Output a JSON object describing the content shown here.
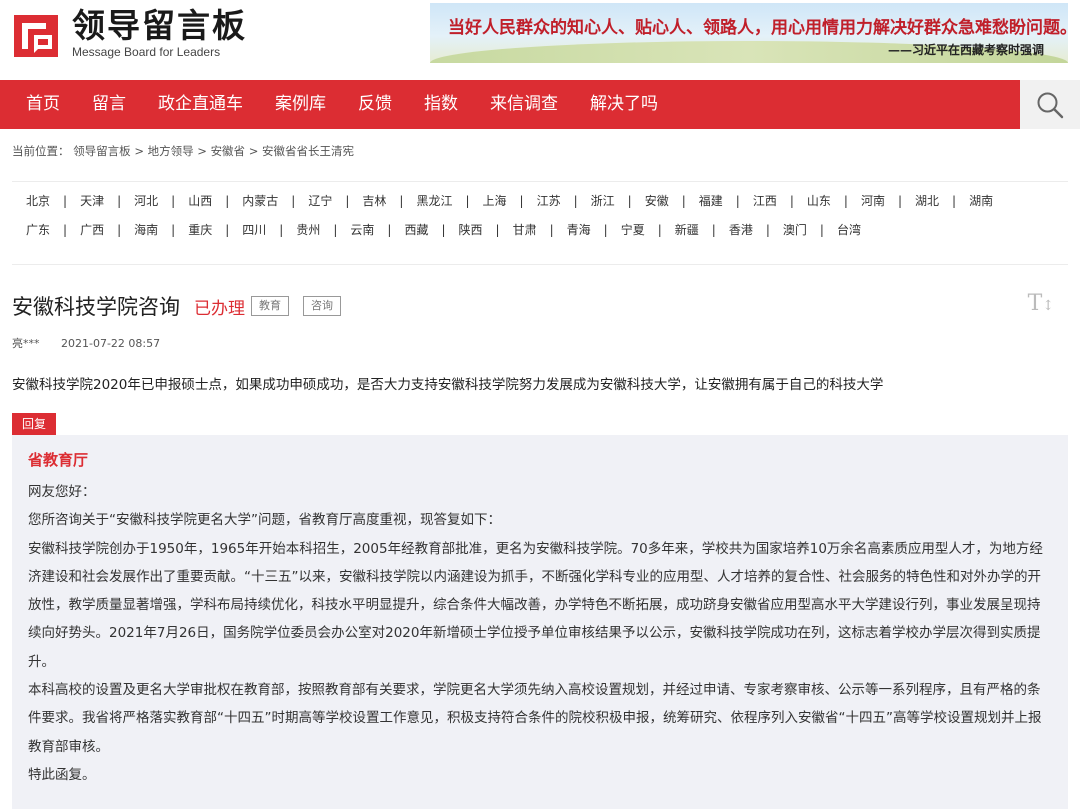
{
  "header": {
    "logo_cn": "领导留言板",
    "logo_en": "Message Board for Leaders",
    "banner_main": "当好人民群众的知心人、贴心人、领路人，用心用情用力解决好群众急难愁盼问题。",
    "banner_sub": "——习近平在西藏考察时强调"
  },
  "nav": {
    "items": [
      "首页",
      "留言",
      "政企直通车",
      "案例库",
      "反馈",
      "指数",
      "来信调查",
      "解决了吗"
    ]
  },
  "breadcrumb": {
    "prefix": "当前位置：",
    "path": [
      "领导留言板",
      "地方领导",
      "安徽省",
      "安徽省省长王清宪"
    ],
    "separator": ">"
  },
  "regions": {
    "row1": [
      "北京",
      "天津",
      "河北",
      "山西",
      "内蒙古",
      "辽宁",
      "吉林",
      "黑龙江",
      "上海",
      "江苏",
      "浙江",
      "安徽",
      "福建",
      "江西",
      "山东",
      "河南",
      "湖北",
      "湖南"
    ],
    "row2": [
      "广东",
      "广西",
      "海南",
      "重庆",
      "四川",
      "贵州",
      "云南",
      "西藏",
      "陕西",
      "甘肃",
      "青海",
      "宁夏",
      "新疆",
      "香港",
      "澳门",
      "台湾"
    ],
    "separator": "|"
  },
  "post": {
    "title": "安徽科技学院咨询",
    "status": "已办理",
    "tags": [
      "教育",
      "咨询"
    ],
    "font_icon_label": "T",
    "author": "亮***",
    "date": "2021-07-22 08:57",
    "content": "安徽科技学院2020年已申报硕士点，如果成功申硕成功，是否大力支持安徽科技学院努力发展成为安徽科技大学，让安徽拥有属于自己的科技大学"
  },
  "reply": {
    "tab_label": "回复",
    "org": "省教育厅",
    "paragraphs": [
      "网友您好：",
      "您所咨询关于“安徽科技学院更名大学”问题，省教育厅高度重视，现答复如下：",
      "安徽科技学院创办于1950年，1965年开始本科招生，2005年经教育部批准，更名为安徽科技学院。70多年来，学校共为国家培养10万余名高素质应用型人才，为地方经济建设和社会发展作出了重要贡献。“十三五”以来，安徽科技学院以内涵建设为抓手，不断强化学科专业的应用型、人才培养的复合性、社会服务的特色性和对外办学的开放性，教学质量显著增强，学科布局持续优化，科技水平明显提升，综合条件大幅改善，办学特色不断拓展，成功跻身安徽省应用型高水平大学建设行列，事业发展呈现持续向好势头。2021年7月26日，国务院学位委员会办公室对2020年新增硕士学位授予单位审核结果予以公示，安徽科技学院成功在列，这标志着学校办学层次得到实质提升。",
      "本科高校的设置及更名大学审批权在教育部，按照教育部有关要求，学院更名大学须先纳入高校设置规划，并经过申请、专家考察审核、公示等一系列程序，且有严格的条件要求。我省将严格落实教育部“十四五”时期高等学校设置工作意见，积极支持符合条件的院校积极申报，统筹研究、依程序列入安徽省“十四五”高等学校设置规划并上报教育部审核。",
      "特此函复。"
    ]
  },
  "colors": {
    "brand_red": "#dc2d33"
  }
}
